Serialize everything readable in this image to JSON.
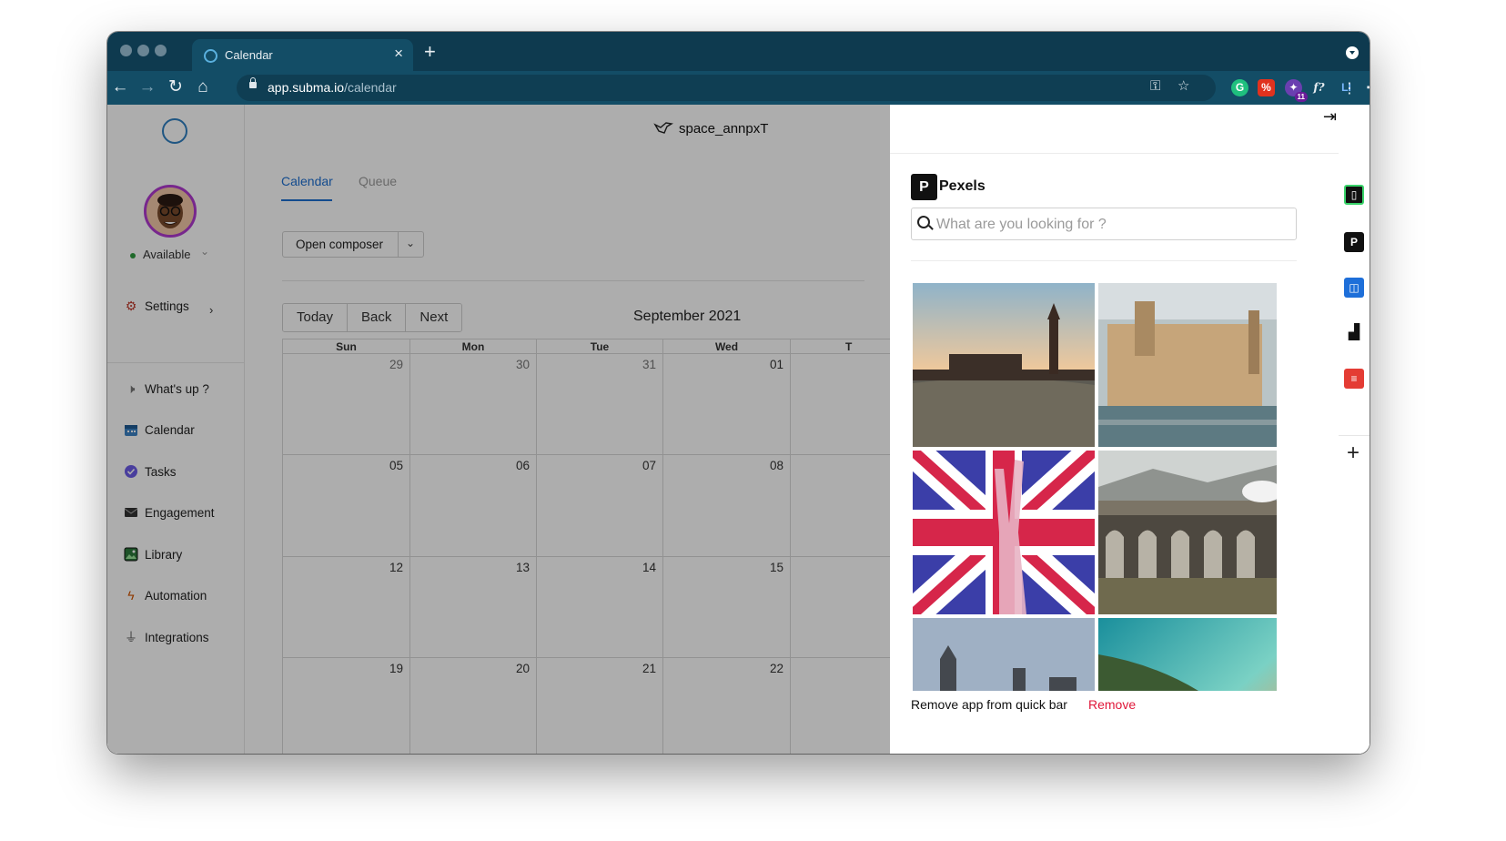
{
  "browser": {
    "tab_title": "Calendar",
    "url_host": "app.subma.io",
    "url_path": "/calendar",
    "extension_badge": "11"
  },
  "sidebar": {
    "status": "Available",
    "settings_label": "Settings",
    "items": [
      {
        "label": "What's up ?",
        "icon": "megaphone-icon"
      },
      {
        "label": "Calendar",
        "icon": "calendar-icon"
      },
      {
        "label": "Tasks",
        "icon": "tasks-icon"
      },
      {
        "label": "Engagement",
        "icon": "engagement-icon"
      },
      {
        "label": "Library",
        "icon": "image-library-icon"
      },
      {
        "label": "Automation",
        "icon": "lightning-icon"
      },
      {
        "label": "Integrations",
        "icon": "plug-icon"
      }
    ]
  },
  "header": {
    "workspace": "space_annpxT"
  },
  "tabs": {
    "calendar": "Calendar",
    "queue": "Queue"
  },
  "composer": {
    "label": "Open composer"
  },
  "calendar": {
    "today": "Today",
    "back": "Back",
    "next": "Next",
    "month": "September 2021",
    "weekdays": [
      "Sun",
      "Mon",
      "Tue",
      "Wed",
      "T"
    ],
    "weeks": [
      [
        "29",
        "30",
        "31",
        "01"
      ],
      [
        "05",
        "06",
        "07",
        "08"
      ],
      [
        "12",
        "13",
        "14",
        "15"
      ],
      [
        "19",
        "20",
        "21",
        "22"
      ]
    ]
  },
  "panel": {
    "app_name": "Pexels",
    "search_placeholder": "What are you looking for ?",
    "remove_text": "Remove app from quick bar",
    "remove_link": "Remove",
    "images": [
      {
        "icon": "photo-big-ben-sunset"
      },
      {
        "icon": "photo-westminster-aerial"
      },
      {
        "icon": "photo-union-jack-peace-hand"
      },
      {
        "icon": "photo-glenfinnan-viaduct"
      },
      {
        "icon": "photo-parliament-silhouette"
      },
      {
        "icon": "photo-coastal-cliff"
      }
    ],
    "rail_apps": [
      "canva-icon",
      "pexels-icon",
      "trello-icon",
      "unsplash-icon",
      "todoist-icon"
    ]
  },
  "colors": {
    "chrome_dark": "#0e3a4f",
    "chrome_toolbar": "#134d66",
    "accent_blue": "#1d6fd1",
    "remove_red": "#e0183a",
    "status_green": "#2e9b3e"
  }
}
